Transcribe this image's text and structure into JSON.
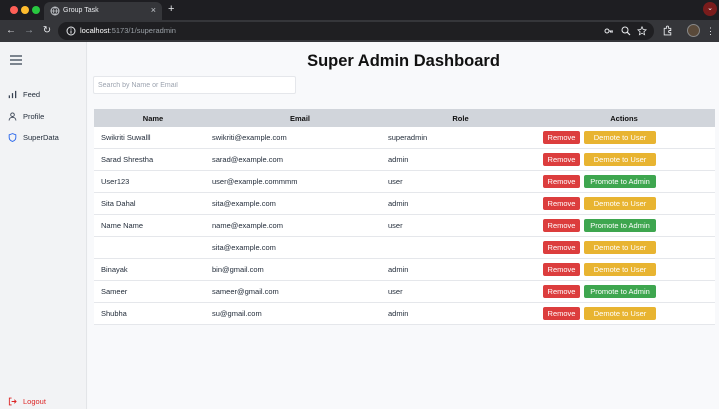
{
  "browser": {
    "tab_title": "Group Task",
    "tab_close": "×",
    "new_tab": "+",
    "url_host": "localhost",
    "url_rest": ":5173/1/superadmin",
    "colors": {
      "frame": "#1e1e22",
      "toolbar": "#35363a"
    }
  },
  "sidebar": {
    "items": [
      {
        "label": "Feed",
        "icon": "bar-chart-icon"
      },
      {
        "label": "Profile",
        "icon": "user-icon"
      },
      {
        "label": "SuperData",
        "icon": "shield-icon"
      }
    ],
    "logout_label": "Logout"
  },
  "main": {
    "title": "Super Admin Dashboard",
    "search_placeholder": "Search by Name or Email",
    "columns": [
      "Name",
      "Email",
      "Role",
      "Actions"
    ],
    "remove_label": "Remove",
    "users": [
      {
        "name": "Swikriti Suwalll",
        "email": "swikriti@example.com",
        "role": "superadmin",
        "action": "Demote to User",
        "action_type": "demote"
      },
      {
        "name": "Sarad Shrestha",
        "email": "sarad@example.com",
        "role": "admin",
        "action": "Demote to User",
        "action_type": "demote"
      },
      {
        "name": "User123",
        "email": "user@example.commmm",
        "role": "user",
        "action": "Promote to Admin",
        "action_type": "promote"
      },
      {
        "name": "Sita Dahal",
        "email": "sita@example.com",
        "role": "admin",
        "action": "Demote to User",
        "action_type": "demote"
      },
      {
        "name": "Name Name",
        "email": "name@example.com",
        "role": "user",
        "action": "Promote to Admin",
        "action_type": "promote"
      },
      {
        "name": "",
        "email": "sita@example.com",
        "role": "",
        "action": "Demote to User",
        "action_type": "demote"
      },
      {
        "name": "Binayak",
        "email": "bin@gmail.com",
        "role": "admin",
        "action": "Demote to User",
        "action_type": "demote"
      },
      {
        "name": "Sameer",
        "email": "sameer@gmail.com",
        "role": "user",
        "action": "Promote to Admin",
        "action_type": "promote"
      },
      {
        "name": "Shubha",
        "email": "su@gmail.com",
        "role": "admin",
        "action": "Demote to User",
        "action_type": "demote"
      }
    ],
    "colors": {
      "remove": "#dc3d3d",
      "demote": "#e8b431",
      "promote": "#3ea64f",
      "header": "#d1d5db"
    }
  }
}
